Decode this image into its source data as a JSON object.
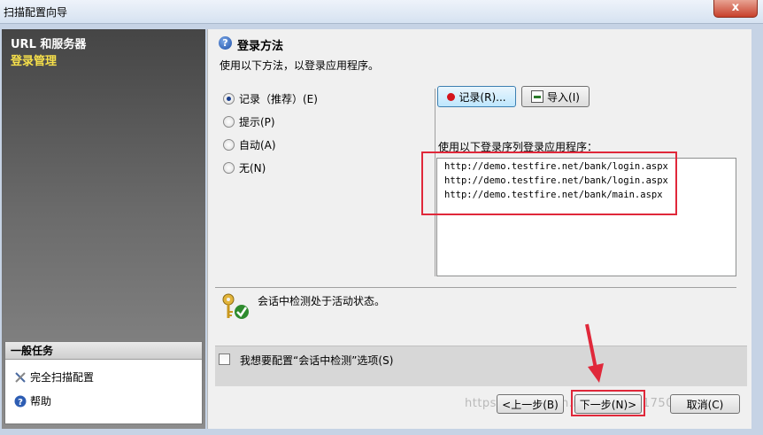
{
  "window": {
    "title": "扫描配置向导",
    "close_glyph": "x"
  },
  "steps": {
    "step1": "URL 和服务器",
    "step2": "登录管理"
  },
  "general_tasks": {
    "header": "一般任务",
    "items": [
      {
        "label": "完全扫描配置",
        "icon": "wrench-screwdriver-icon"
      },
      {
        "label": "帮助",
        "icon": "help-icon"
      }
    ]
  },
  "main": {
    "header_icon": "?",
    "title": "登录方法",
    "subtitle": "使用以下方法，以登录应用程序。",
    "options": [
      {
        "label": "记录（推荐）(E)",
        "selected": true
      },
      {
        "label": "提示(P)",
        "selected": false
      },
      {
        "label": "自动(A)",
        "selected": false
      },
      {
        "label": "无(N)",
        "selected": false
      }
    ],
    "record_button": "记录(R)...",
    "import_button": "导入(I)",
    "sequence_label": "使用以下登录序列登录应用程序：",
    "sequence": [
      "http://demo.testfire.net/bank/login.aspx",
      "http://demo.testfire.net/bank/login.aspx",
      "http://demo.testfire.net/bank/main.aspx"
    ],
    "session_status": "会话中检测处于活动状态。",
    "checkbox_label": "我想要配置“会话中检测”选项(S)",
    "checkbox_checked": false
  },
  "footer": {
    "back": "<上一步(B)",
    "next": "下一步(N)>",
    "cancel": "取消(C)"
  },
  "watermark": "https://blog.csdn.net/qq_38517509",
  "colors": {
    "highlight_red": "#e0283a",
    "record_dot": "#d4141c",
    "step_active": "#f7e04a"
  }
}
